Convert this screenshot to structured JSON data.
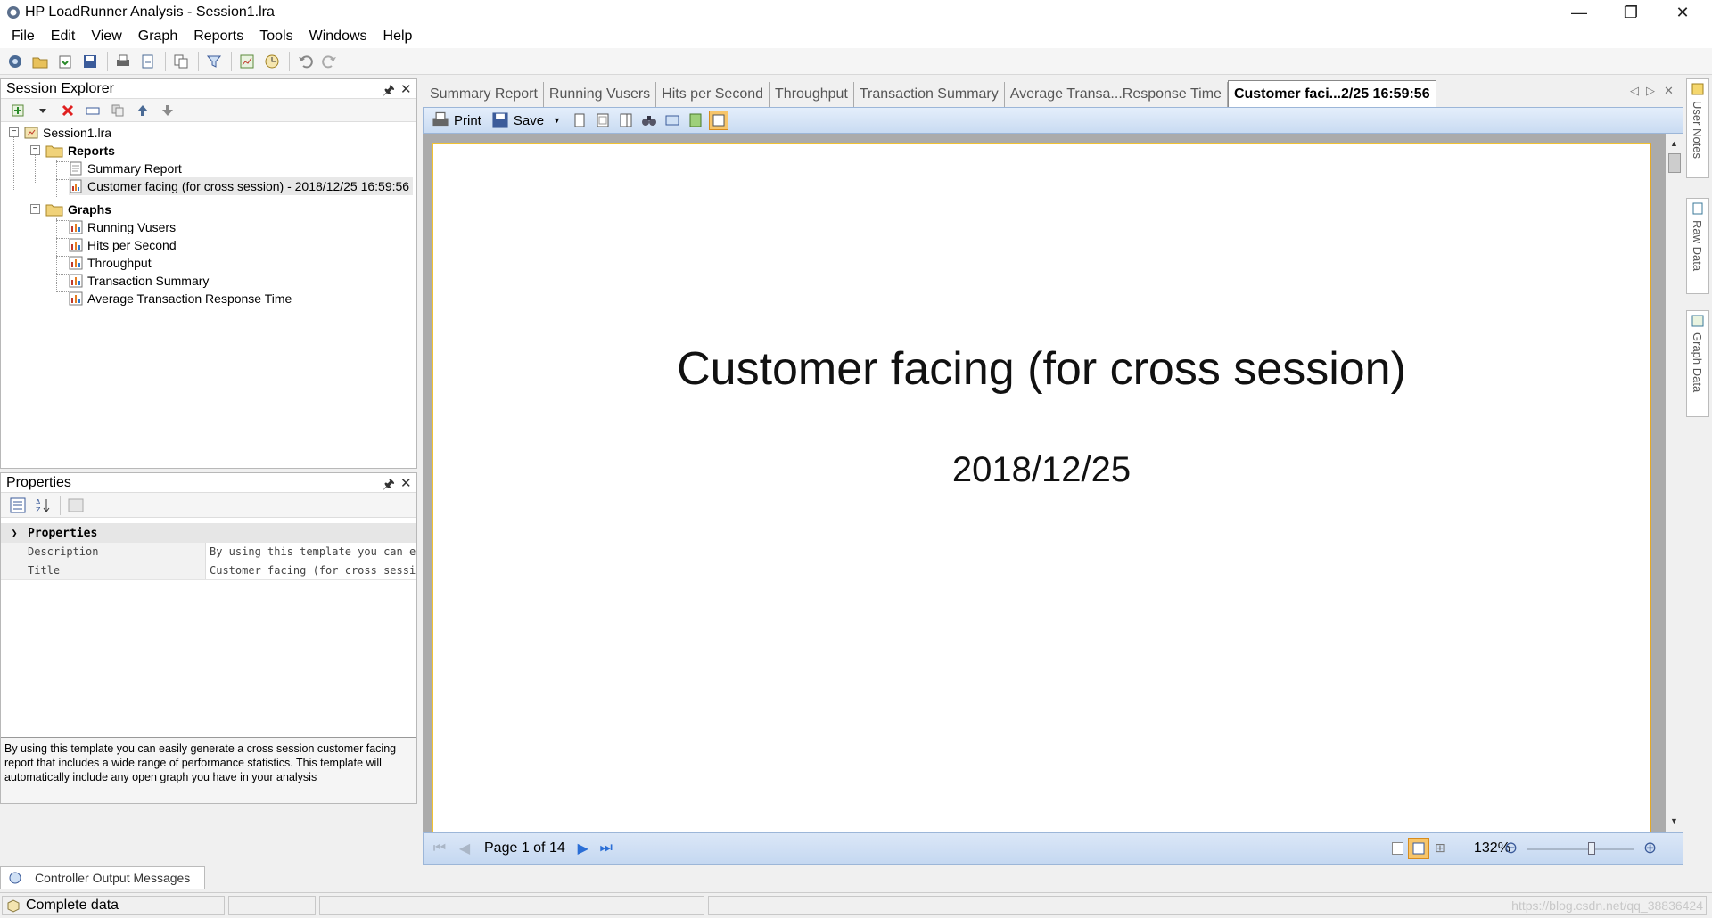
{
  "window": {
    "title": "HP LoadRunner Analysis - Session1.lra",
    "controls": {
      "minimize": "—",
      "restore": "❐",
      "close": "✕"
    }
  },
  "menu": [
    "File",
    "Edit",
    "View",
    "Graph",
    "Reports",
    "Tools",
    "Windows",
    "Help"
  ],
  "session_explorer": {
    "title": "Session Explorer",
    "tree": {
      "root": "Session1.lra",
      "reports_label": "Reports",
      "reports": [
        "Summary Report",
        "Customer facing (for cross session) - 2018/12/25 16:59:56"
      ],
      "graphs_label": "Graphs",
      "graphs": [
        "Running Vusers",
        "Hits per Second",
        "Throughput",
        "Transaction Summary",
        "Average Transaction Response Time"
      ]
    }
  },
  "properties": {
    "title": "Properties",
    "category": "Properties",
    "rows": [
      {
        "name": "Description",
        "value": "By using this template you can easily generate a cross session customer facing report"
      },
      {
        "name": "Title",
        "value": "Customer facing (for cross session)"
      }
    ],
    "description": "By using this template you can easily generate a cross session customer facing report that includes a wide range of performance statistics. This template will automatically include any open graph you have in your analysis"
  },
  "output_tab": "Controller Output Messages",
  "status": {
    "text": "Complete data",
    "watermark": "https://blog.csdn.net/qq_38836424"
  },
  "document_tabs": [
    "Summary Report",
    "Running Vusers",
    "Hits per Second",
    "Throughput",
    "Transaction Summary",
    "Average Transa...Response Time",
    "Customer faci...2/25  16:59:56"
  ],
  "viewer_toolbar": {
    "print": "Print",
    "save": "Save"
  },
  "report": {
    "title": "Customer facing (for cross session)",
    "date": "2018/12/25"
  },
  "viewer_footer": {
    "page": "Page 1 of 14",
    "zoom": "132%",
    "zoom_level": 0.6
  },
  "right_dock": [
    "User Notes",
    "Raw Data",
    "Graph Data"
  ]
}
